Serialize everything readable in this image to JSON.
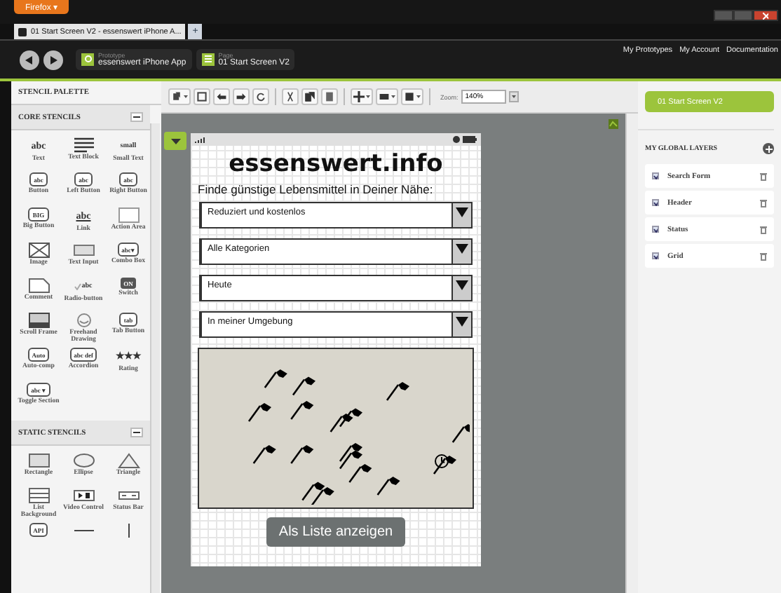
{
  "browser": {
    "menu_button": "Firefox ▾",
    "tabs": [
      {
        "title": "01 Start Screen V2 - essenswert iPhone A...",
        "selected": true
      }
    ],
    "new_tab": "+"
  },
  "header": {
    "breadcrumbs": [
      {
        "caption": "Prototype",
        "value": "essenswert iPhone App",
        "kind": "prototype"
      },
      {
        "caption": "Page",
        "value": "01 Start Screen V2",
        "kind": "page"
      }
    ],
    "links": [
      "My Prototypes",
      "My Account",
      "Documentation"
    ]
  },
  "palette": {
    "title": "STENCIL PALETTE",
    "sections": [
      {
        "title": "CORE STENCILS",
        "expanded": true,
        "items": [
          {
            "label": "Text",
            "kind": "text",
            "glyph": "abc"
          },
          {
            "label": "Text Block",
            "kind": "lines"
          },
          {
            "label": "Small Text",
            "kind": "small",
            "glyph": "small"
          },
          {
            "label": "Button",
            "kind": "boxed",
            "glyph": "abc"
          },
          {
            "label": "Left Button",
            "kind": "boxed",
            "glyph": "abc"
          },
          {
            "label": "Right Button",
            "kind": "boxed",
            "glyph": "abc"
          },
          {
            "label": "Big Button",
            "kind": "boxed",
            "glyph": "BIG"
          },
          {
            "label": "Link",
            "kind": "link",
            "glyph": "abc"
          },
          {
            "label": "Action Area",
            "kind": "area"
          },
          {
            "label": "Image",
            "kind": "image"
          },
          {
            "label": "Text Input",
            "kind": "input"
          },
          {
            "label": "Combo Box",
            "kind": "boxed",
            "glyph": "abc▾"
          },
          {
            "label": "Comment",
            "kind": "comment"
          },
          {
            "label": "Radio-button",
            "kind": "radio",
            "glyph": "abc"
          },
          {
            "label": "Switch",
            "kind": "switch",
            "glyph": "ON"
          },
          {
            "label": "Scroll Frame",
            "kind": "scroll"
          },
          {
            "label": "Freehand Drawing",
            "kind": "freehand"
          },
          {
            "label": "Tab Button",
            "kind": "boxed",
            "glyph": "tab"
          },
          {
            "label": "Auto-comp",
            "kind": "boxed",
            "glyph": "Auto"
          },
          {
            "label": "Accordion",
            "kind": "boxed",
            "glyph": "abc def"
          },
          {
            "label": "Rating",
            "kind": "text",
            "glyph": "★★★"
          },
          {
            "label": "Toggle Section",
            "kind": "boxed",
            "glyph": "abc ▾"
          }
        ]
      },
      {
        "title": "STATIC STENCILS",
        "expanded": true,
        "items": [
          {
            "label": "Rectangle",
            "kind": "rectangle"
          },
          {
            "label": "Ellipse",
            "kind": "ellipse"
          },
          {
            "label": "Triangle",
            "kind": "triangle"
          },
          {
            "label": "List Background",
            "kind": "list"
          },
          {
            "label": "Video Control",
            "kind": "video"
          },
          {
            "label": "Status Bar",
            "kind": "statusbar"
          },
          {
            "kind": "tag",
            "glyph": "API"
          },
          {
            "kind": "hline"
          },
          {
            "kind": "vline"
          }
        ]
      }
    ]
  },
  "toolbar": {
    "zoom_label": "Zoom:",
    "zoom_value": "140%"
  },
  "phone": {
    "title": "essenswert.info",
    "subtitle": "Finde günstige Lebensmittel in Deiner Nähe:",
    "dropdowns": [
      "Reduziert und kostenlos",
      "Alle Kategorien",
      "Heute",
      "In meiner Umgebung"
    ],
    "button": "Als Liste anzeigen"
  },
  "pages_button": "01 Start Screen V2",
  "layers": {
    "title": "MY GLOBAL LAYERS",
    "items": [
      {
        "name": "Search Form",
        "checked": true
      },
      {
        "name": "Header",
        "checked": true
      },
      {
        "name": "Status",
        "checked": true
      },
      {
        "name": "Grid",
        "checked": true
      }
    ]
  }
}
